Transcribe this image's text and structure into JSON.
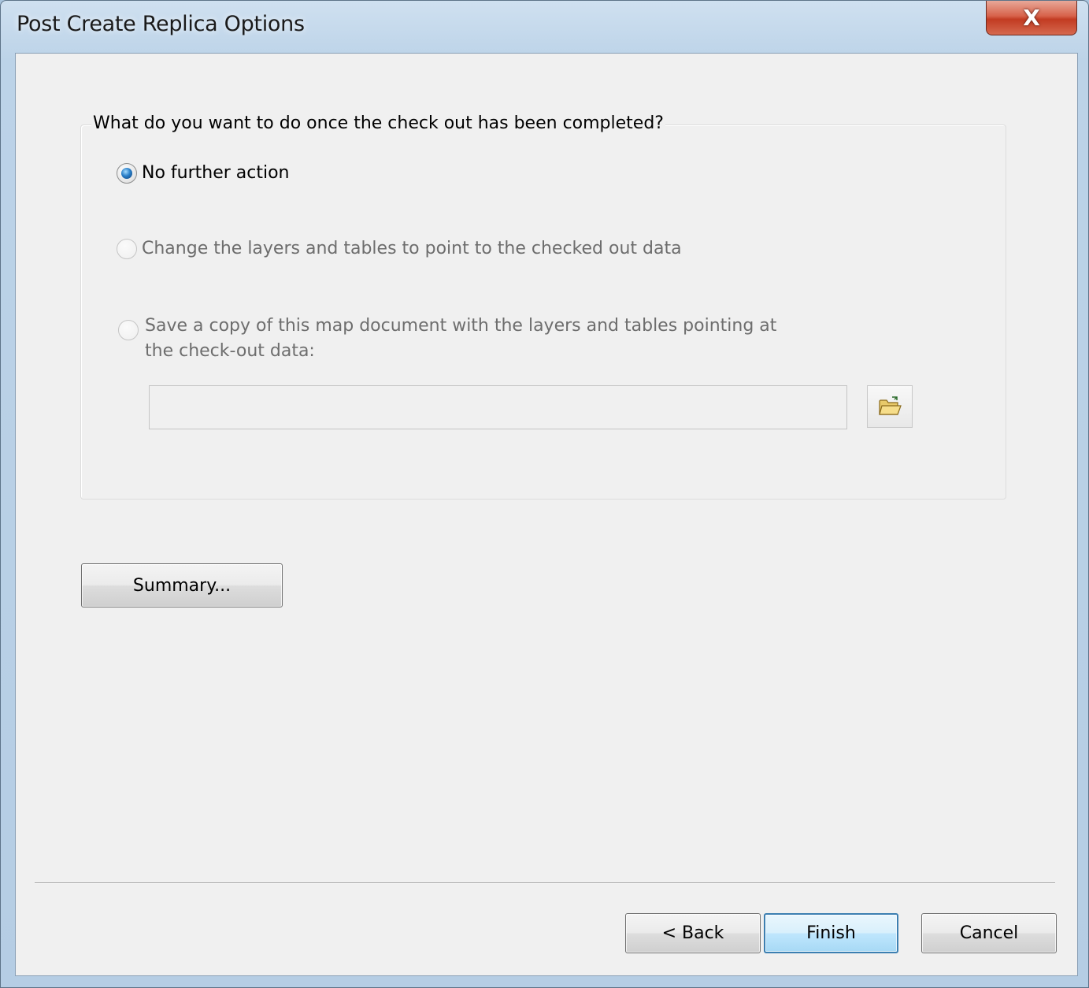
{
  "window": {
    "title": "Post Create Replica Options",
    "close_label": "X"
  },
  "group": {
    "legend": "What do you want to do once the check out has been completed?",
    "options": [
      {
        "label": "No further action",
        "checked": true,
        "enabled": true
      },
      {
        "label": "Change the layers and tables to point to the checked out data",
        "checked": false,
        "enabled": false
      },
      {
        "label_line1": "Save a copy of this map document with the layers and tables pointing at",
        "label_line2": "the check-out data:",
        "checked": false,
        "enabled": false
      }
    ],
    "path_input": {
      "value": "",
      "placeholder": ""
    }
  },
  "buttons": {
    "summary": "Summary...",
    "back": "< Back",
    "finish": "Finish",
    "cancel": "Cancel"
  },
  "icons": {
    "browse": "open-folder-icon"
  },
  "colors": {
    "dialog_bg": "#f0f0f0",
    "close_red": "#c23b22",
    "default_button_border": "#3c7fb1",
    "disabled_text": "#6d6d6d"
  }
}
